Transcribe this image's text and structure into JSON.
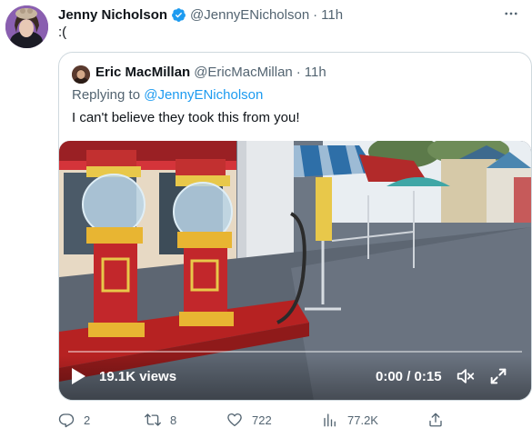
{
  "tweet": {
    "author_name": "Jenny Nicholson",
    "author_handle": "@JennyENicholson",
    "separator": "·",
    "time": "11h",
    "text": ":(",
    "more_icon": "more-horizontal-icon",
    "verified_color": "#1d9bf0"
  },
  "quote": {
    "author_name": "Eric MacMillan",
    "author_handle": "@EricMacMillan",
    "separator": "·",
    "time": "11h",
    "replying_prefix": "Replying to",
    "replying_handle": "@JennyENicholson",
    "text": "I can't believe they took this from you!",
    "video": {
      "views": "19.1K views",
      "time_display": "0:00 / 0:15",
      "progress": 0.0
    }
  },
  "actions": {
    "reply_count": "2",
    "retweet_count": "8",
    "like_count": "722",
    "views_count": "77.2K"
  },
  "colors": {
    "text_primary": "#0f1419",
    "text_secondary": "#536471",
    "link": "#1d9bf0",
    "border": "#cfd9de"
  }
}
